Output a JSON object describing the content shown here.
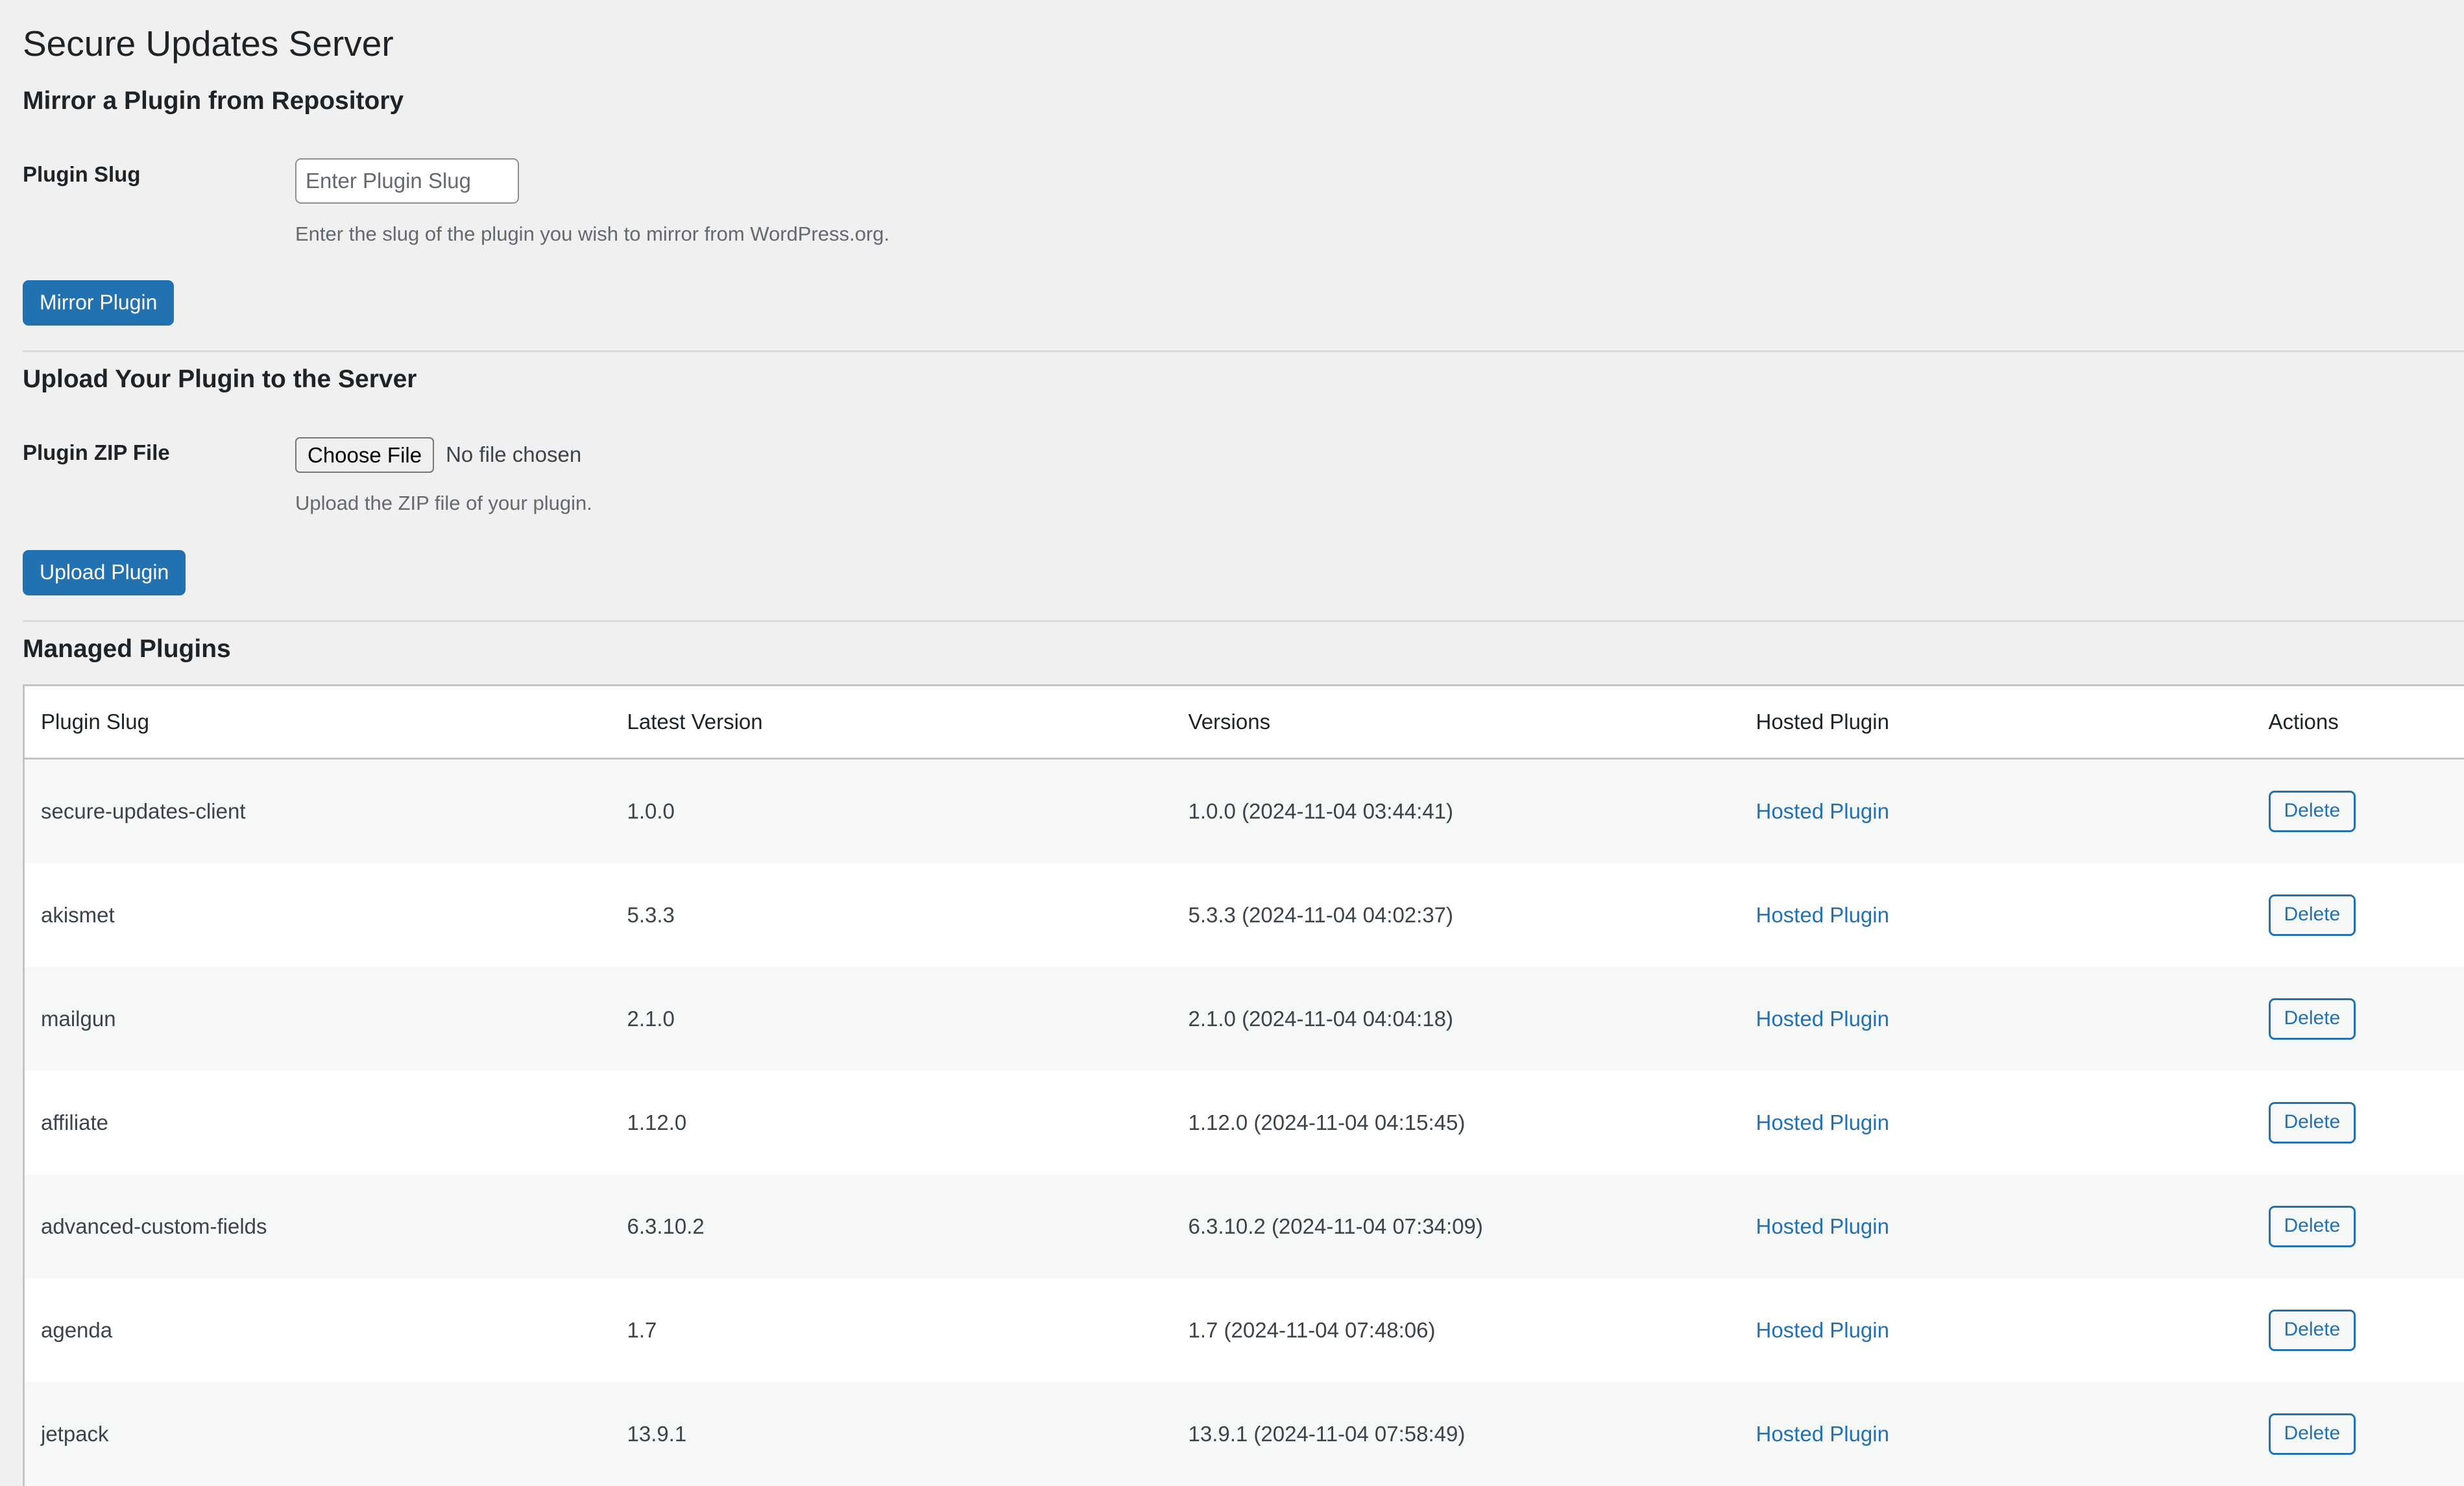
{
  "page": {
    "title": "Secure Updates Server"
  },
  "mirror_section": {
    "heading": "Mirror a Plugin from Repository",
    "slug_label": "Plugin Slug",
    "slug_placeholder": "Enter Plugin Slug",
    "slug_value": "",
    "slug_description": "Enter the slug of the plugin you wish to mirror from WordPress.org.",
    "submit_label": "Mirror Plugin"
  },
  "upload_section": {
    "heading": "Upload Your Plugin to the Server",
    "file_label": "Plugin ZIP File",
    "choose_file_label": "Choose File",
    "no_file_text": "No file chosen",
    "file_description": "Upload the ZIP file of your plugin.",
    "submit_label": "Upload Plugin"
  },
  "managed_section": {
    "heading": "Managed Plugins",
    "columns": [
      "Plugin Slug",
      "Latest Version",
      "Versions",
      "Hosted Plugin",
      "Actions"
    ],
    "delete_label": "Delete",
    "rows": [
      {
        "slug": "secure-updates-client",
        "latest_version": "1.0.0",
        "versions": "1.0.0 (2024-11-04 03:44:41)",
        "hosted": "Hosted Plugin"
      },
      {
        "slug": "akismet",
        "latest_version": "5.3.3",
        "versions": "5.3.3 (2024-11-04 04:02:37)",
        "hosted": "Hosted Plugin"
      },
      {
        "slug": "mailgun",
        "latest_version": "2.1.0",
        "versions": "2.1.0 (2024-11-04 04:04:18)",
        "hosted": "Hosted Plugin"
      },
      {
        "slug": "affiliate",
        "latest_version": "1.12.0",
        "versions": "1.12.0 (2024-11-04 04:15:45)",
        "hosted": "Hosted Plugin"
      },
      {
        "slug": "advanced-custom-fields",
        "latest_version": "6.3.10.2",
        "versions": "6.3.10.2 (2024-11-04 07:34:09)",
        "hosted": "Hosted Plugin"
      },
      {
        "slug": "agenda",
        "latest_version": "1.7",
        "versions": "1.7 (2024-11-04 07:48:06)",
        "hosted": "Hosted Plugin"
      },
      {
        "slug": "jetpack",
        "latest_version": "13.9.1",
        "versions": "13.9.1 (2024-11-04 07:58:49)",
        "hosted": "Hosted Plugin"
      }
    ]
  },
  "colors": {
    "page_background": "#f0f0f1",
    "primary_button": "#2271b1",
    "link": "#2271b1",
    "text": "#1d2327",
    "muted_text": "#646970",
    "row_stripe": "#f6f7f7",
    "border": "#c3c4c7"
  }
}
